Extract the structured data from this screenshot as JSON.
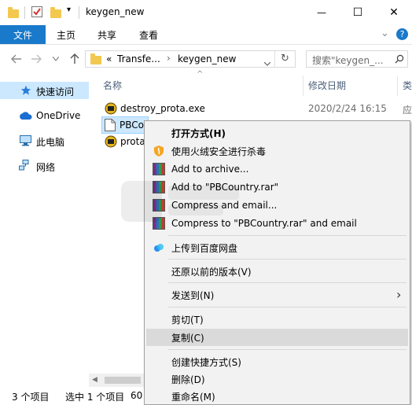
{
  "window": {
    "title": "keygen_new",
    "minimize_glyph": "—",
    "maximize_glyph": "☐",
    "close_glyph": "✕"
  },
  "ribbon": {
    "tabs": [
      "文件",
      "主页",
      "共享",
      "查看"
    ],
    "collapse_glyph": "⌄",
    "help_glyph": "?"
  },
  "address_bar": {
    "overflow": "«",
    "segment1": "Transfe...",
    "chevron": "›",
    "segment2": "keygen_new",
    "refresh_glyph": "↻"
  },
  "search": {
    "placeholder": "搜索\"keygen_..."
  },
  "nav_pane": {
    "items": [
      {
        "label": "快速访问",
        "icon": "star-icon"
      },
      {
        "label": "OneDrive",
        "icon": "cloud-icon"
      },
      {
        "label": "此电脑",
        "icon": "computer-icon"
      },
      {
        "label": "网络",
        "icon": "network-icon"
      }
    ]
  },
  "file_list": {
    "columns": {
      "name": "名称",
      "date": "修改日期",
      "type": "类"
    },
    "sort_glyph": "^",
    "files": [
      {
        "name": "destroy_prota.exe",
        "date": "2020/2/24 16:15",
        "type": "应"
      },
      {
        "name": "PBCo",
        "date": "",
        "type": ""
      },
      {
        "name": "prota",
        "date": "",
        "type": ""
      }
    ]
  },
  "context_menu": {
    "items": [
      {
        "label": "打开方式(H)",
        "bold": true
      },
      {
        "label": "使用火绒安全进行杀毒"
      },
      {
        "label": "Add to archive..."
      },
      {
        "label": "Add to \"PBCountry.rar\""
      },
      {
        "label": "Compress and email..."
      },
      {
        "label": "Compress to \"PBCountry.rar\" and email"
      },
      {
        "label": "上传到百度网盘"
      },
      {
        "label": "还原以前的版本(V)"
      },
      {
        "label": "发送到(N)"
      },
      {
        "label": "剪切(T)"
      },
      {
        "label": "复制(C)"
      },
      {
        "label": "创建快捷方式(S)"
      },
      {
        "label": "删除(D)"
      },
      {
        "label": "重命名(M)"
      }
    ],
    "submenu_glyph": "›"
  },
  "status_bar": {
    "count": "3 个项目",
    "selected": "选中 1 个项目",
    "size": "60"
  },
  "colors": {
    "accent": "#1979ca",
    "selected_bg": "#cce8ff",
    "hover_bg": "#dadada"
  }
}
